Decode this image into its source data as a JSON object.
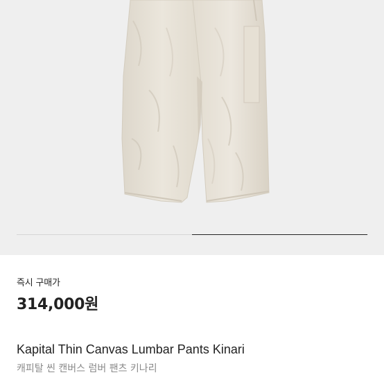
{
  "product": {
    "image_description_icon": "pants-photo",
    "carousel": {
      "total_slides": 2,
      "active_slide": 2
    },
    "price_label": "즉시 구매가",
    "price": "314,000원",
    "name_en": "Kapital Thin Canvas Lumbar Pants Kinari",
    "name_ko": "캐피탈 씬 캔버스 럼버 팬츠 키나리"
  },
  "colors": {
    "image_background": "#efefef",
    "fabric": "#e8e2d6",
    "text_primary": "#222222",
    "text_secondary": "#8a8a8a"
  }
}
